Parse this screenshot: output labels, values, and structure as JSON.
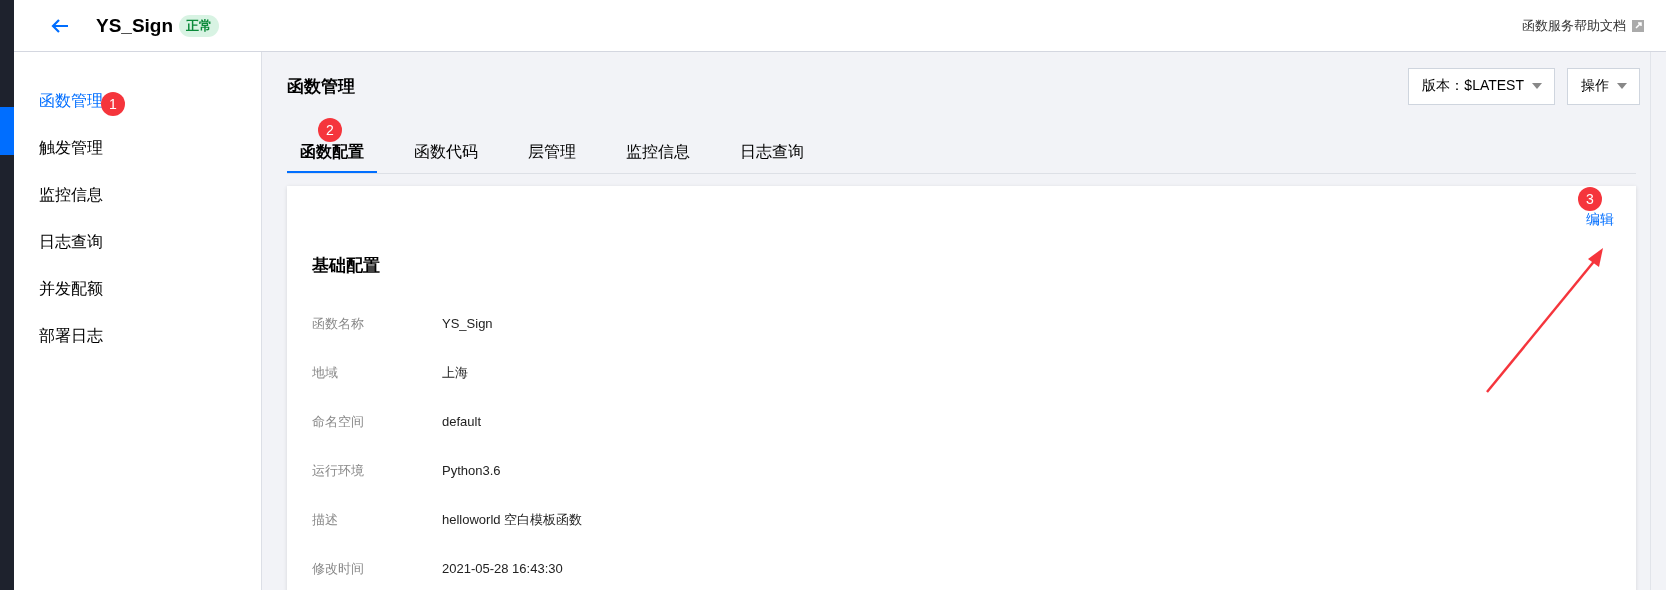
{
  "header": {
    "title": "YS_Sign",
    "status": "正常",
    "help_link": "函数服务帮助文档"
  },
  "sidebar": {
    "items": [
      {
        "label": "函数管理",
        "selected": true,
        "marker": "1"
      },
      {
        "label": "触发管理",
        "selected": false
      },
      {
        "label": "监控信息",
        "selected": false
      },
      {
        "label": "日志查询",
        "selected": false
      },
      {
        "label": "并发配额",
        "selected": false
      },
      {
        "label": "部署日志",
        "selected": false
      }
    ]
  },
  "page": {
    "title": "函数管理",
    "version_select": "版本：$LATEST",
    "actions_select": "操作"
  },
  "tabs": [
    {
      "label": "函数配置",
      "selected": true,
      "marker": "2"
    },
    {
      "label": "函数代码",
      "selected": false
    },
    {
      "label": "层管理",
      "selected": false
    },
    {
      "label": "监控信息",
      "selected": false
    },
    {
      "label": "日志查询",
      "selected": false
    }
  ],
  "card": {
    "edit_link": "编辑",
    "edit_marker": "3",
    "section_title": "基础配置",
    "fields": [
      {
        "label": "函数名称",
        "value": "YS_Sign"
      },
      {
        "label": "地域",
        "value": "上海"
      },
      {
        "label": "命名空间",
        "value": "default"
      },
      {
        "label": "运行环境",
        "value": "Python3.6"
      },
      {
        "label": "描述",
        "value": "helloworld 空白模板函数"
      },
      {
        "label": "修改时间",
        "value": "2021-05-28 16:43:30"
      }
    ]
  }
}
